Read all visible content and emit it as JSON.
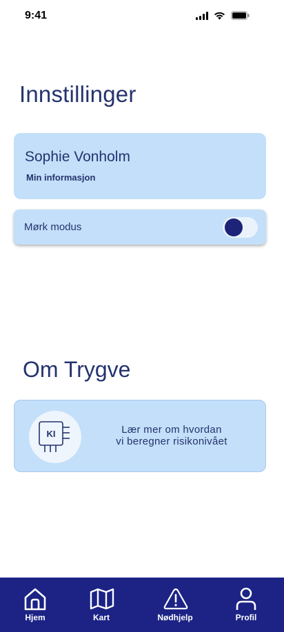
{
  "status": {
    "time": "9:41"
  },
  "settings": {
    "title": "Innstillinger",
    "profile": {
      "name": "Sophie Vonholm",
      "link": "Min informasjon"
    },
    "dark_mode": {
      "label": "Mørk modus",
      "enabled": false
    }
  },
  "about": {
    "title": "Om Trygve",
    "badge": "KI",
    "card_text": "Lær mer om hvordan vi beregner risikonivået"
  },
  "tabs": [
    {
      "label": "Hjem",
      "icon": "home-icon"
    },
    {
      "label": "Kart",
      "icon": "map-icon"
    },
    {
      "label": "Nødhjelp",
      "icon": "warning-icon"
    },
    {
      "label": "Profil",
      "icon": "user-icon"
    }
  ]
}
